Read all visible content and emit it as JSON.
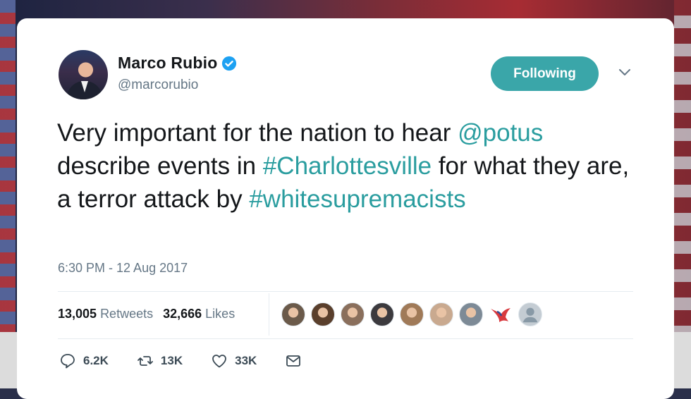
{
  "author": {
    "name": "Marco Rubio",
    "handle": "@marcorubio",
    "verified": true
  },
  "follow_button": {
    "label": "Following",
    "color": "#3aa6a9"
  },
  "tweet": {
    "parts": [
      {
        "text": "Very important for the nation to hear ",
        "link": false
      },
      {
        "text": "@potus",
        "link": true
      },
      {
        "text": " describe events in ",
        "link": false
      },
      {
        "text": "#Charlottesville",
        "link": true
      },
      {
        "text": " for what they are, a terror attack by ",
        "link": false
      },
      {
        "text": "#whitesupremacists",
        "link": true
      }
    ],
    "link_color": "#2a9d9f",
    "timestamp": "6:30 PM - 12 Aug 2017"
  },
  "stats": {
    "retweets_count": "13,005",
    "retweets_label": "Retweets",
    "likes_count": "32,666",
    "likes_label": "Likes"
  },
  "likers": [
    {
      "icon": "liker-avatar",
      "color": "#6b5a4a"
    },
    {
      "icon": "liker-avatar",
      "color": "#5a3f2c"
    },
    {
      "icon": "liker-avatar",
      "color": "#8a6f5c"
    },
    {
      "icon": "liker-avatar",
      "color": "#3c3a3e"
    },
    {
      "icon": "liker-avatar",
      "color": "#a07a58"
    },
    {
      "icon": "liker-avatar",
      "color": "#c9a98f"
    },
    {
      "icon": "liker-avatar",
      "color": "#7d8a96"
    },
    {
      "icon": "bird-logo-avatar",
      "color": "#ffffff"
    },
    {
      "icon": "default-avatar",
      "color": "#c4ccd3"
    }
  ],
  "actions": {
    "reply_count": "6.2K",
    "retweet_count": "13K",
    "like_count": "33K"
  }
}
